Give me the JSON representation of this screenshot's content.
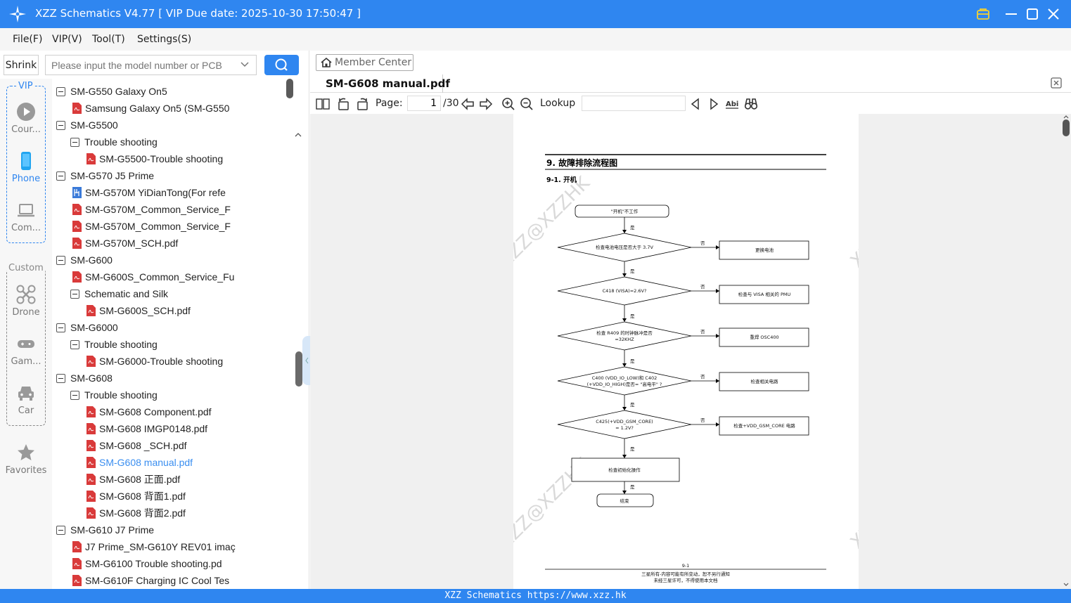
{
  "window": {
    "title": "XZZ Schematics V4.77 [ VIP Due date: 2025-10-30 17:50:47 ]"
  },
  "menu": [
    "File(F)",
    "VIP(V)",
    "Tool(T)",
    "Settings(S)"
  ],
  "search": {
    "shrink_label": "Shrink",
    "placeholder": "Please input the model number or PCB"
  },
  "sidebar": {
    "vip_label": "VIP",
    "custom_label": "Custom",
    "items": [
      {
        "label": "Cour..."
      },
      {
        "label": "Phone"
      },
      {
        "label": "Com..."
      },
      {
        "label": "Drone"
      },
      {
        "label": "Gam..."
      },
      {
        "label": "Car"
      },
      {
        "label": "Favorites"
      }
    ]
  },
  "tree": [
    {
      "label": "SM-G550 Galaxy On5",
      "type": "folder",
      "level": 0
    },
    {
      "label": "Samsung Galaxy On5 (SM-G550",
      "type": "pdf",
      "level": 1
    },
    {
      "label": "SM-G5500",
      "type": "folder",
      "level": 0
    },
    {
      "label": "Trouble shooting",
      "type": "folder",
      "level": 1
    },
    {
      "label": "SM-G5500-Trouble shooting",
      "type": "pdf",
      "level": 2
    },
    {
      "label": "SM-G570 J5 Prime",
      "type": "folder",
      "level": 0
    },
    {
      "label": "SM-G570M YiDianTong(For refe",
      "type": "board",
      "level": 1
    },
    {
      "label": "SM-G570M_Common_Service_F",
      "type": "pdf",
      "level": 1
    },
    {
      "label": "SM-G570M_Common_Service_F",
      "type": "pdf",
      "level": 1
    },
    {
      "label": "SM-G570M_SCH.pdf",
      "type": "pdf",
      "level": 1
    },
    {
      "label": "SM-G600",
      "type": "folder",
      "level": 0
    },
    {
      "label": "SM-G600S_Common_Service_Fu",
      "type": "pdf",
      "level": 1
    },
    {
      "label": "Schematic and Silk",
      "type": "folder",
      "level": 1
    },
    {
      "label": "SM-G600S_SCH.pdf",
      "type": "pdf",
      "level": 2
    },
    {
      "label": "SM-G6000",
      "type": "folder",
      "level": 0
    },
    {
      "label": "Trouble shooting",
      "type": "folder",
      "level": 1
    },
    {
      "label": "SM-G6000-Trouble shooting",
      "type": "pdf",
      "level": 2
    },
    {
      "label": "SM-G608",
      "type": "folder",
      "level": 0
    },
    {
      "label": "Trouble shooting",
      "type": "folder",
      "level": 1
    },
    {
      "label": "SM-G608 Component.pdf",
      "type": "pdf",
      "level": 2
    },
    {
      "label": "SM-G608 IMGP0148.pdf",
      "type": "pdf",
      "level": 2
    },
    {
      "label": "SM-G608 _SCH.pdf",
      "type": "pdf",
      "level": 2
    },
    {
      "label": "SM-G608 manual.pdf",
      "type": "pdf",
      "level": 2,
      "selected": true
    },
    {
      "label": "SM-G608 正面.pdf",
      "type": "pdf",
      "level": 2
    },
    {
      "label": "SM-G608 背面1.pdf",
      "type": "pdf",
      "level": 2
    },
    {
      "label": "SM-G608 背面2.pdf",
      "type": "pdf",
      "level": 2
    },
    {
      "label": "SM-G610 J7 Prime",
      "type": "folder",
      "level": 0
    },
    {
      "label": "J7 Prime_SM-G610Y REV01 imaç",
      "type": "pdf",
      "level": 1
    },
    {
      "label": "SM-G6100 Trouble shooting.pd",
      "type": "pdf",
      "level": 1
    },
    {
      "label": "SM-G610F Charging IC Cool Tes",
      "type": "pdf",
      "level": 1
    }
  ],
  "viewer": {
    "member_center": "Member Center",
    "tab_title": "SM-G608 manual.pdf",
    "page_label": "Page:",
    "page_current": "1",
    "page_total": "/30",
    "lookup_label": "Lookup"
  },
  "document": {
    "heading": "9.  故障排除流程图",
    "subheading": "9-1.  开机",
    "flow": {
      "start": "\"开机\"不工作",
      "yes": "是",
      "no": "否",
      "decisions": [
        {
          "q": "检查电池电压是否大于 3.7V",
          "action": "更换电池"
        },
        {
          "q": "C418 (VISA)=2.6V?",
          "action": "检查与 VISA 相关的 PMU"
        },
        {
          "q1": "检查 R409 的时钟脉冲是否",
          "q2": "=32KHZ",
          "action": "重焊 OSC400"
        },
        {
          "q1": "C400 (VDD_IO_LOW)和 C402",
          "q2": "(+VDD_IO_HIGH)是否= \"高电平\" ?",
          "action": "检查相关电路"
        },
        {
          "q1": "C425(+VDD_GSM_CORE)",
          "q2": "= 1.2V?",
          "action": "检查+VDD_GSM_CORE 电路"
        }
      ],
      "final_step": "检查初始化操作",
      "end": "结束"
    },
    "watermark": "XZZ@XZZHK",
    "page_no": "9-1",
    "footer1": "三星所有-内容可能有所变动，恕不另行通知",
    "footer2": "未经三星许可，不得使用本文档"
  },
  "status": "XZZ Schematics https://www.xzz.hk",
  "colors": {
    "accent": "#2f86f0",
    "pdf_red": "#d93a3a",
    "selected_text": "#3a8ef0"
  }
}
